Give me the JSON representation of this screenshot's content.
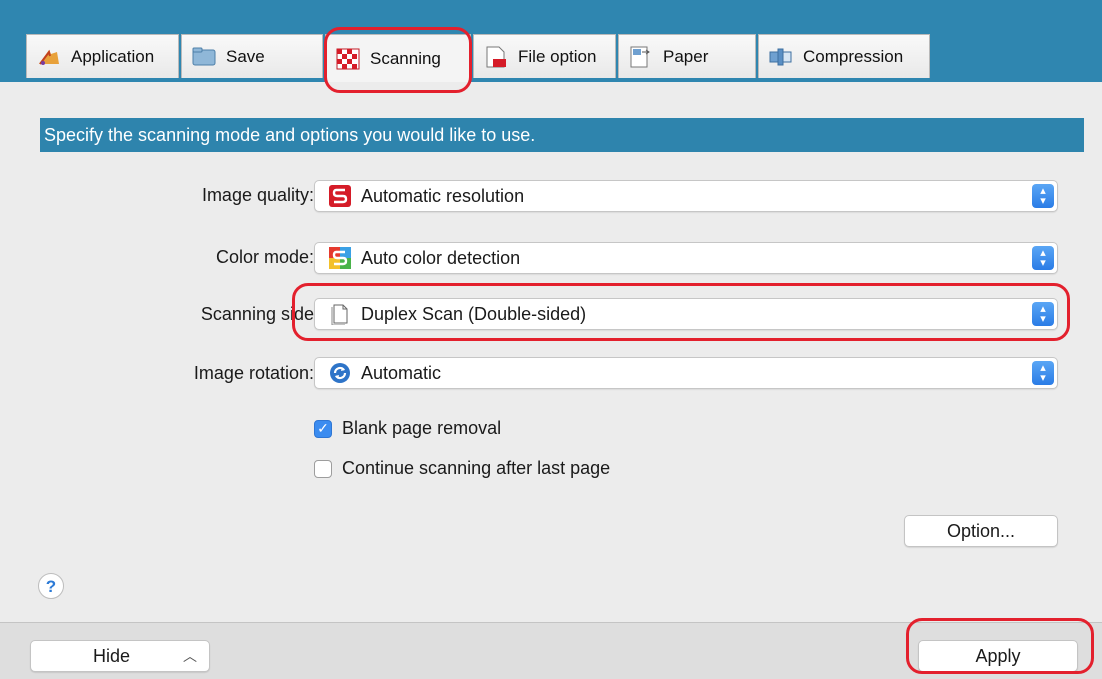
{
  "tabs": [
    {
      "label": "Application",
      "icon": "application-icon"
    },
    {
      "label": "Save",
      "icon": "folder-icon"
    },
    {
      "label": "Scanning",
      "icon": "scanning-icon"
    },
    {
      "label": "File option",
      "icon": "file-option-icon"
    },
    {
      "label": "Paper",
      "icon": "paper-icon"
    },
    {
      "label": "Compression",
      "icon": "compression-icon"
    }
  ],
  "active_tab": "Scanning",
  "banner": "Specify the scanning mode and options you would like to use.",
  "fields": {
    "image_quality": {
      "label": "Image quality:",
      "value": "Automatic resolution"
    },
    "color_mode": {
      "label": "Color mode:",
      "value": "Auto color detection"
    },
    "scanning_side": {
      "label": "Scanning side",
      "value": "Duplex Scan (Double-sided)"
    },
    "image_rotation": {
      "label": "Image rotation:",
      "value": "Automatic"
    }
  },
  "checkboxes": {
    "blank_page_removal": {
      "label": "Blank page removal",
      "checked": true
    },
    "continue_scanning": {
      "label": "Continue scanning after last page",
      "checked": false
    }
  },
  "buttons": {
    "option": "Option...",
    "help": "?",
    "hide": "Hide",
    "apply": "Apply"
  },
  "colors": {
    "accent": "#2f86b0",
    "highlight": "#e3202d",
    "checkbox": "#3b8cf0"
  }
}
